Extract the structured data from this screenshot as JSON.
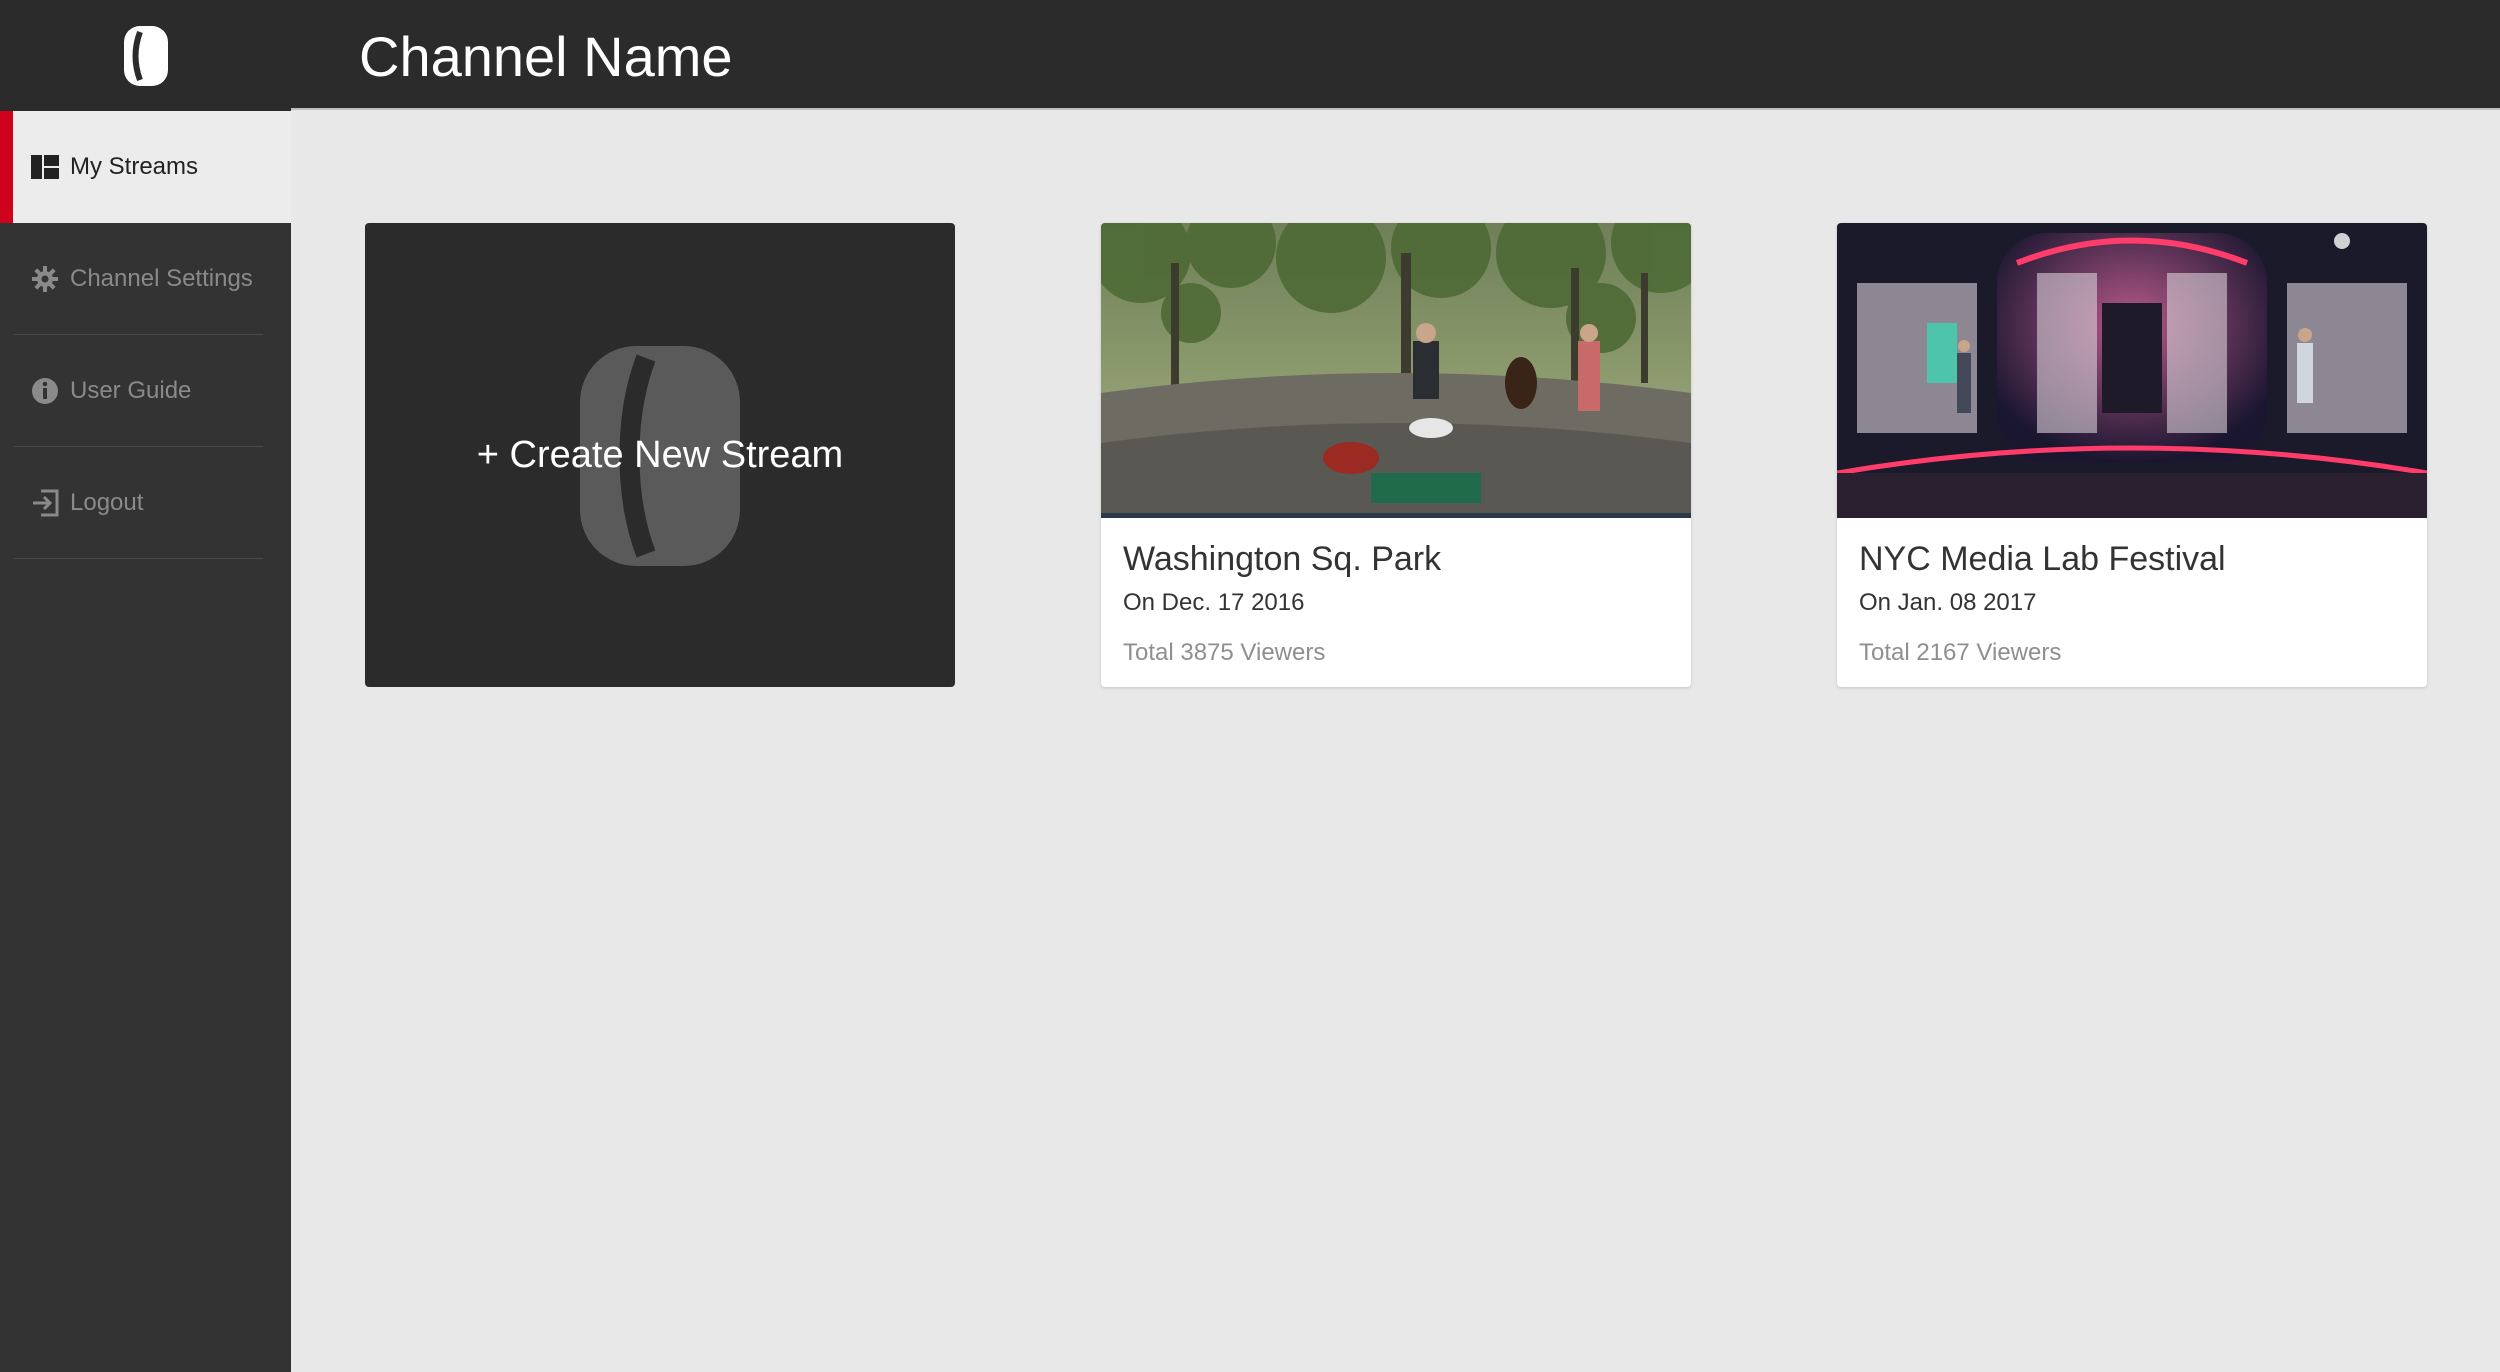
{
  "header": {
    "title": "Channel Name"
  },
  "sidebar": {
    "items": [
      {
        "label": "My Streams",
        "icon": "dashboard-icon",
        "active": true
      },
      {
        "label": "Channel Settings",
        "icon": "gear-icon"
      },
      {
        "label": "User Guide",
        "icon": "info-icon"
      },
      {
        "label": "Logout",
        "icon": "logout-icon"
      }
    ]
  },
  "create": {
    "label": "+ Create New Stream"
  },
  "streams": [
    {
      "name": "Washington Sq. Park",
      "date": "On Dec. 17 2016",
      "viewers": "Total 3875 Viewers"
    },
    {
      "name": "NYC Media Lab Festival",
      "date": "On Jan. 08 2017",
      "viewers": "Total 2167 Viewers"
    }
  ],
  "colors": {
    "accent": "#d0021b",
    "sidebar": "#333333",
    "header": "#2b2b2b",
    "background": "#e8e8e8"
  }
}
